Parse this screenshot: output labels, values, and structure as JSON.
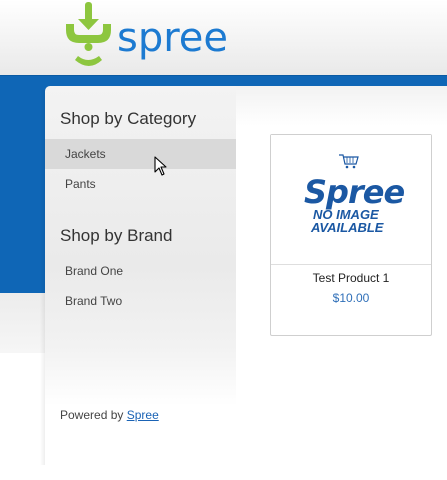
{
  "header": {
    "logo_text": "spree"
  },
  "sidebar": {
    "category_heading": "Shop by Category",
    "categories": [
      {
        "label": "Jackets"
      },
      {
        "label": "Pants"
      }
    ],
    "brand_heading": "Shop by Brand",
    "brands": [
      {
        "label": "Brand One"
      },
      {
        "label": "Brand Two"
      }
    ]
  },
  "footer": {
    "powered_text": "Powered by",
    "powered_link": "Spree"
  },
  "products": [
    {
      "name": "Test Product 1",
      "price": "$10.00",
      "placeholder": {
        "brand": "Spree",
        "line1": "NO IMAGE",
        "line2": "AVAILABLE"
      }
    }
  ],
  "colors": {
    "brand_green": "#8dc63f",
    "brand_blue": "#0f66b6",
    "link_blue": "#1a63b5"
  }
}
